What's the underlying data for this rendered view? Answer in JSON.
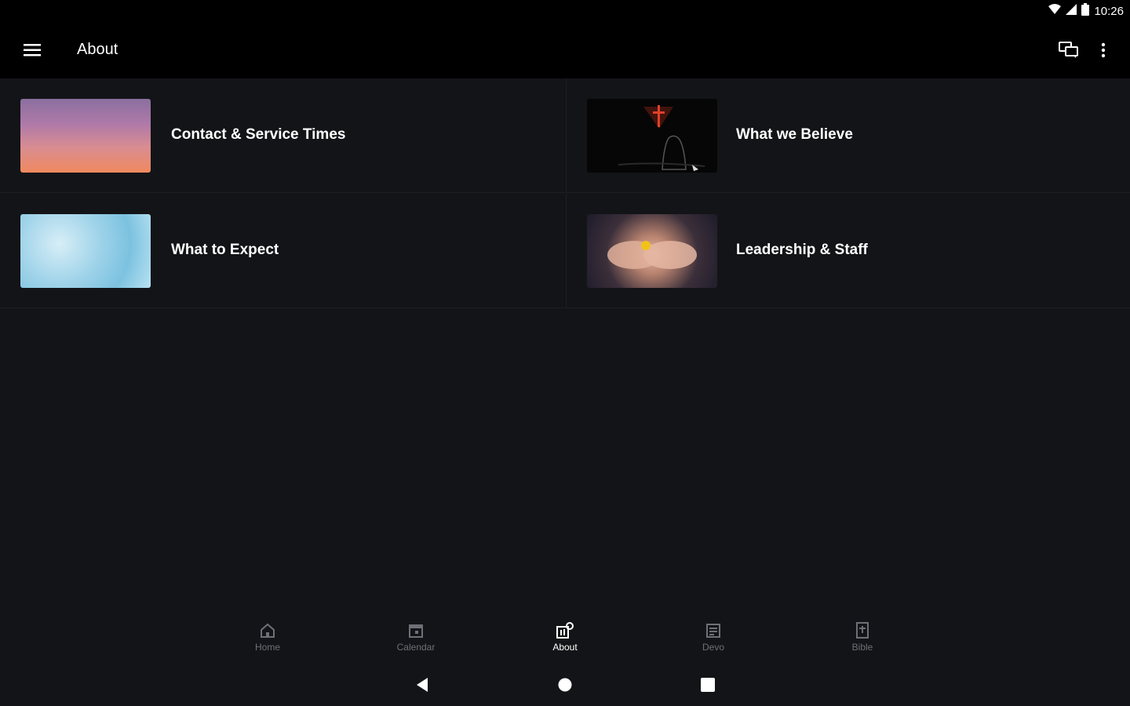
{
  "status": {
    "time": "10:26"
  },
  "toolbar": {
    "title": "About"
  },
  "cards": [
    {
      "label": "Contact & Service Times",
      "image": "sunset-sky"
    },
    {
      "label": "What we Believe",
      "image": "cross-silhouette"
    },
    {
      "label": "What to Expect",
      "image": "blue-ice"
    },
    {
      "label": "Leadership & Staff",
      "image": "open-hands"
    }
  ],
  "bottom_nav": [
    {
      "label": "Home",
      "icon": "home-icon"
    },
    {
      "label": "Calendar",
      "icon": "calendar-icon"
    },
    {
      "label": "About",
      "icon": "about-icon",
      "active": true
    },
    {
      "label": "Devo",
      "icon": "devo-icon"
    },
    {
      "label": "Bible",
      "icon": "bible-icon"
    }
  ],
  "colors": {
    "background": "#131417",
    "bar": "#000000",
    "inactive_label": "#6d7077",
    "accent_red": "#e0402a"
  }
}
